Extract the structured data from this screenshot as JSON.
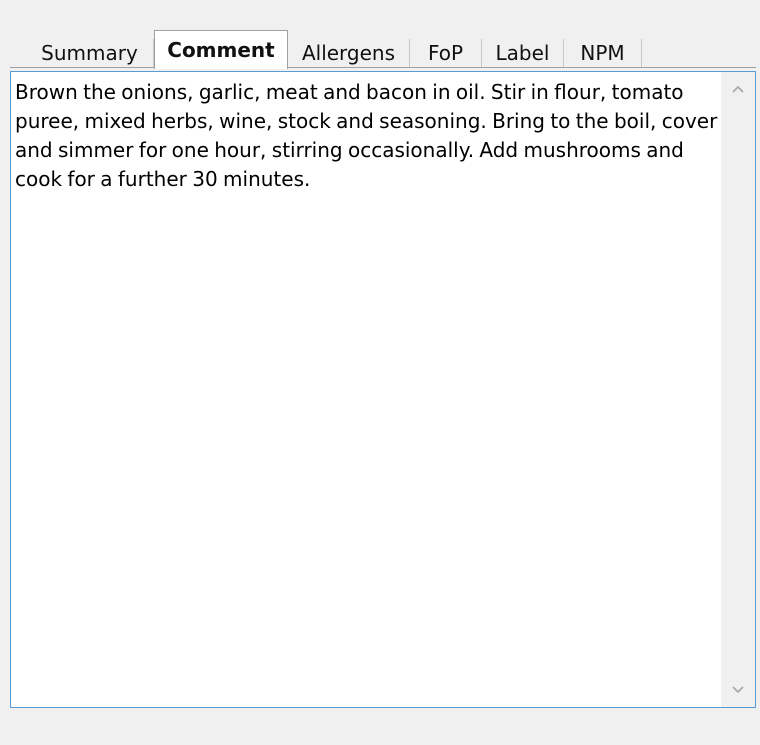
{
  "tabs": [
    {
      "label": "Summary",
      "active": false
    },
    {
      "label": "Comment",
      "active": true
    },
    {
      "label": "Allergens",
      "active": false
    },
    {
      "label": "FoP",
      "active": false
    },
    {
      "label": "Label",
      "active": false
    },
    {
      "label": "NPM",
      "active": false
    }
  ],
  "comment": {
    "text": "Brown the onions, garlic, meat and bacon in oil. Stir in flour, tomato puree, mixed herbs, wine, stock and seasoning. Bring to the boil, cover and simmer for one hour, stirring occasionally. Add mushrooms and cook for a further 30 minutes."
  },
  "scrollbar": {
    "up_icon": "chevron-up-icon",
    "down_icon": "chevron-down-icon"
  },
  "colors": {
    "editor_border": "#5b9bd5",
    "window_bg": "#f0f0f0"
  }
}
